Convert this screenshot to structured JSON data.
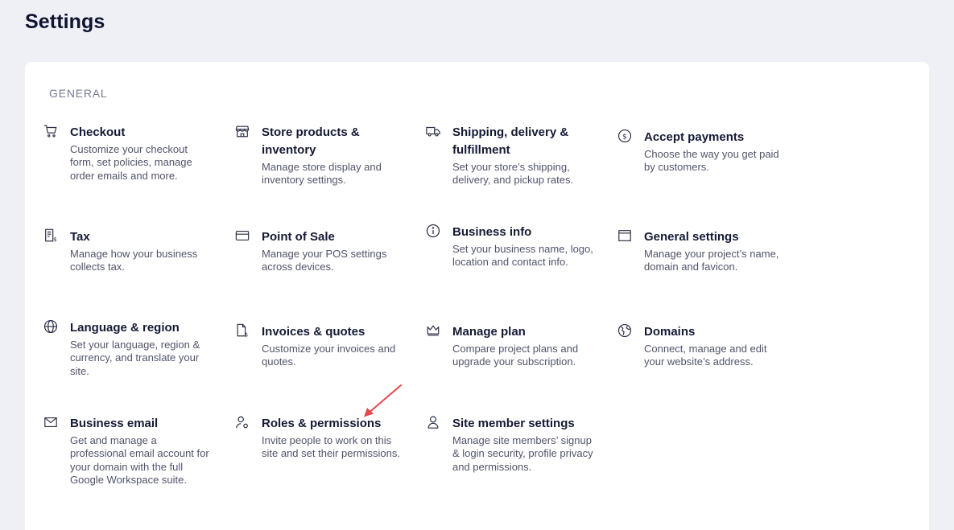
{
  "page": {
    "title": "Settings"
  },
  "section": {
    "label": "GENERAL"
  },
  "tiles": [
    {
      "icon": "cart-icon",
      "title": "Checkout",
      "desc": "Customize your checkout form, set policies, manage order emails and more."
    },
    {
      "icon": "storefront-icon",
      "title": "Store products & inventory",
      "desc": "Manage store display and inventory settings."
    },
    {
      "icon": "truck-icon",
      "title": "Shipping, delivery & fulfillment",
      "desc": "Set your store’s shipping, delivery, and pickup rates."
    },
    {
      "icon": "dollar-circle-icon",
      "title": "Accept payments",
      "desc": "Choose the way you get paid by customers."
    },
    {
      "icon": "receipt-tax-icon",
      "title": "Tax",
      "desc": "Manage how your business collects tax."
    },
    {
      "icon": "card-reader-icon",
      "title": "Point of Sale",
      "desc": "Manage your POS settings across devices."
    },
    {
      "icon": "info-circle-icon",
      "title": "Business info",
      "desc": "Set your business name, logo, location and contact info."
    },
    {
      "icon": "browser-window-icon",
      "title": "General settings",
      "desc": "Manage your project’s name, domain and favicon."
    },
    {
      "icon": "globe-icon",
      "title": "Language & region",
      "desc": "Set your language, region & currency, and translate your site."
    },
    {
      "icon": "invoice-icon",
      "title": "Invoices & quotes",
      "desc": "Customize your invoices and quotes."
    },
    {
      "icon": "crown-icon",
      "title": "Manage plan",
      "desc": "Compare project plans and upgrade your subscription."
    },
    {
      "icon": "domain-globe-icon",
      "title": "Domains",
      "desc": "Connect, manage and edit your website’s address."
    },
    {
      "icon": "envelope-icon",
      "title": "Business email",
      "desc": "Get and manage a professional email account for your domain with the full Google Workspace suite."
    },
    {
      "icon": "user-gear-icon",
      "title": "Roles & permissions",
      "desc": "Invite people to work on this site and set their permissions."
    },
    {
      "icon": "person-icon",
      "title": "Site member settings",
      "desc": "Manage site members’ signup & login security, profile privacy and permissions."
    }
  ],
  "colors": {
    "background": "#eef0f5",
    "card": "#ffffff",
    "text": "#151a35",
    "annotation_arrow": "#e5484d"
  }
}
